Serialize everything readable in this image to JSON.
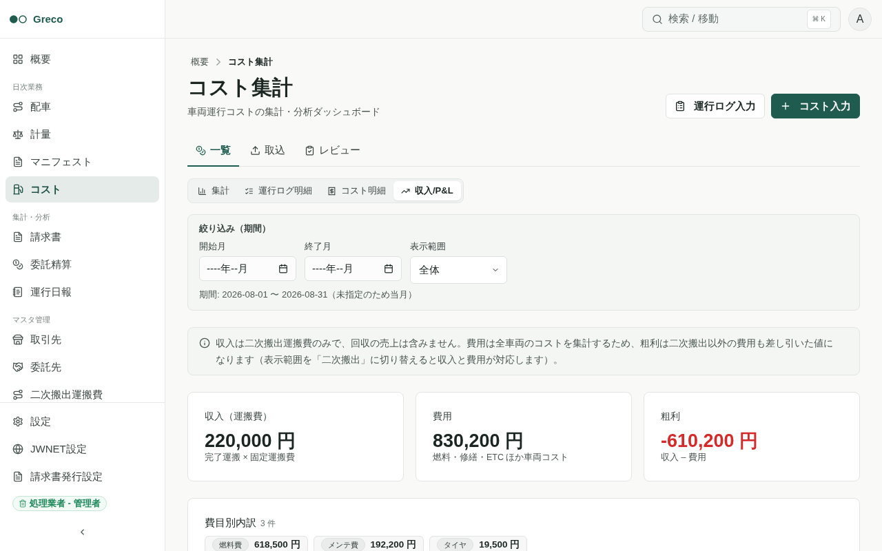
{
  "sidebar": {
    "brand": "Greco",
    "groups": [
      {
        "items": [
          {
            "label": "概要",
            "selected": false
          }
        ]
      },
      {
        "heading": "日次業務",
        "items": [
          {
            "label": "配車",
            "selected": false
          },
          {
            "label": "計量",
            "selected": false
          },
          {
            "label": "マニフェスト",
            "selected": false
          },
          {
            "label": "コスト",
            "selected": true
          }
        ]
      },
      {
        "heading": "集計・分析",
        "items": [
          {
            "label": "請求書",
            "selected": false
          },
          {
            "label": "委託精算",
            "selected": false
          },
          {
            "label": "運行日報",
            "selected": false
          }
        ]
      },
      {
        "heading": "マスタ管理",
        "items": [
          {
            "label": "取引先",
            "selected": false
          },
          {
            "label": "委託先",
            "selected": false
          },
          {
            "label": "二次搬出運搬費",
            "selected": false
          }
        ]
      }
    ],
    "footer_items": [
      {
        "label": "設定",
        "selected": false
      },
      {
        "label": "JWNET設定",
        "selected": false
      },
      {
        "label": "請求書発行設定",
        "selected": false
      }
    ],
    "role_badge": "処理業者 - 管理者"
  },
  "top_bar": {
    "search": {
      "placeholder": "検索 / 移動",
      "shortcut": "⌘ K"
    },
    "avatar": "A"
  },
  "breadcrumb": [
    {
      "label": "概要",
      "current": false
    },
    {
      "label": "コスト集計",
      "current": true
    }
  ],
  "page": {
    "title": "コスト集計",
    "subtitle": "車両運行コストの集計・分析ダッシュボード"
  },
  "actions": [
    {
      "label": "運行ログ入力",
      "kind": "secondary"
    },
    {
      "label": "コスト入力",
      "kind": "primary"
    }
  ],
  "tabs": [
    {
      "label": "一覧",
      "selected": true
    },
    {
      "label": "取込",
      "selected": false
    },
    {
      "label": "レビュー",
      "selected": false
    }
  ],
  "view_tabs": [
    {
      "label": "集計",
      "selected": false
    },
    {
      "label": "運行ログ明細",
      "selected": false
    },
    {
      "label": "コスト明細",
      "selected": false
    },
    {
      "label": "収入/P&L",
      "selected": true
    }
  ],
  "filter": {
    "title": "絞り込み（期間）",
    "fields": [
      {
        "label": "開始月",
        "kind": "month",
        "placeholder": "----年--月"
      },
      {
        "label": "終了月",
        "kind": "month",
        "placeholder": "----年--月"
      },
      {
        "label": "表示範囲",
        "kind": "select",
        "value": "全体"
      }
    ],
    "period": "期間: 2026-08-01 〜 2026-08-31（未指定のため当月）"
  },
  "notice": "収入は二次搬出運搬費のみで、回収の売上は含みません。費用は全車両のコストを集計するため、粗利は二次搬出以外の費用も差し引いた値になります（表示範囲を「二次搬出」に切り替えると収入と費用が対応します）。",
  "stats": [
    {
      "label": "収入（運搬費）",
      "value": "220,000 円",
      "note": "完了運搬 × 固定運搬費",
      "negative": false
    },
    {
      "label": "費用",
      "value": "830,200 円",
      "note": "燃料・修繕・ETC ほか車両コスト",
      "negative": false
    },
    {
      "label": "粗利",
      "value": "-610,200 円",
      "note": "収入 – 費用",
      "negative": true
    }
  ],
  "breakdown": {
    "title": "費目別内訳",
    "count": "3 件",
    "items": [
      {
        "category": "燃料費",
        "amount": "618,500 円"
      },
      {
        "category": "メンテ費",
        "amount": "192,200 円"
      },
      {
        "category": "タイヤ",
        "amount": "19,500 円"
      }
    ]
  }
}
